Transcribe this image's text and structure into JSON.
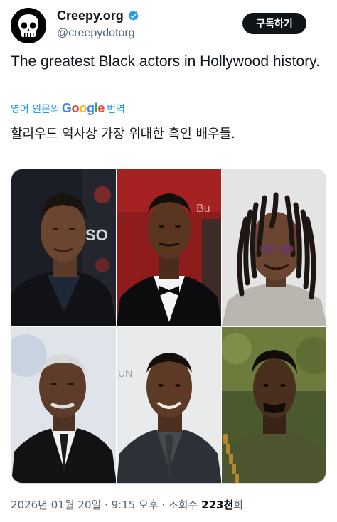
{
  "author": {
    "display_name": "Creepy.org",
    "handle": "@creepydotorg",
    "verified": true,
    "avatar_icon": "skull-icon"
  },
  "subscribe_label": "구독하기",
  "tweet": {
    "text": "The greatest Black actors in Hollywood history.",
    "translate_prefix": "영어 원문의",
    "translate_brand": "Google",
    "translate_suffix": "번역",
    "translated_text": "할리우드 역사상 가장 위대한 흑인 배우들."
  },
  "media": {
    "photo_count": 6,
    "backdrop_text": [
      "SO",
      "Bu",
      "UN"
    ]
  },
  "meta": {
    "timestamp": "2026년 01월 20일 · 9:15 오후 · 조회수",
    "views": "223천",
    "views_suffix": "회"
  },
  "colors": {
    "link": "#1d9bf0",
    "text": "#0f1419",
    "secondary": "#536471",
    "verified": "#1d9bf0"
  }
}
